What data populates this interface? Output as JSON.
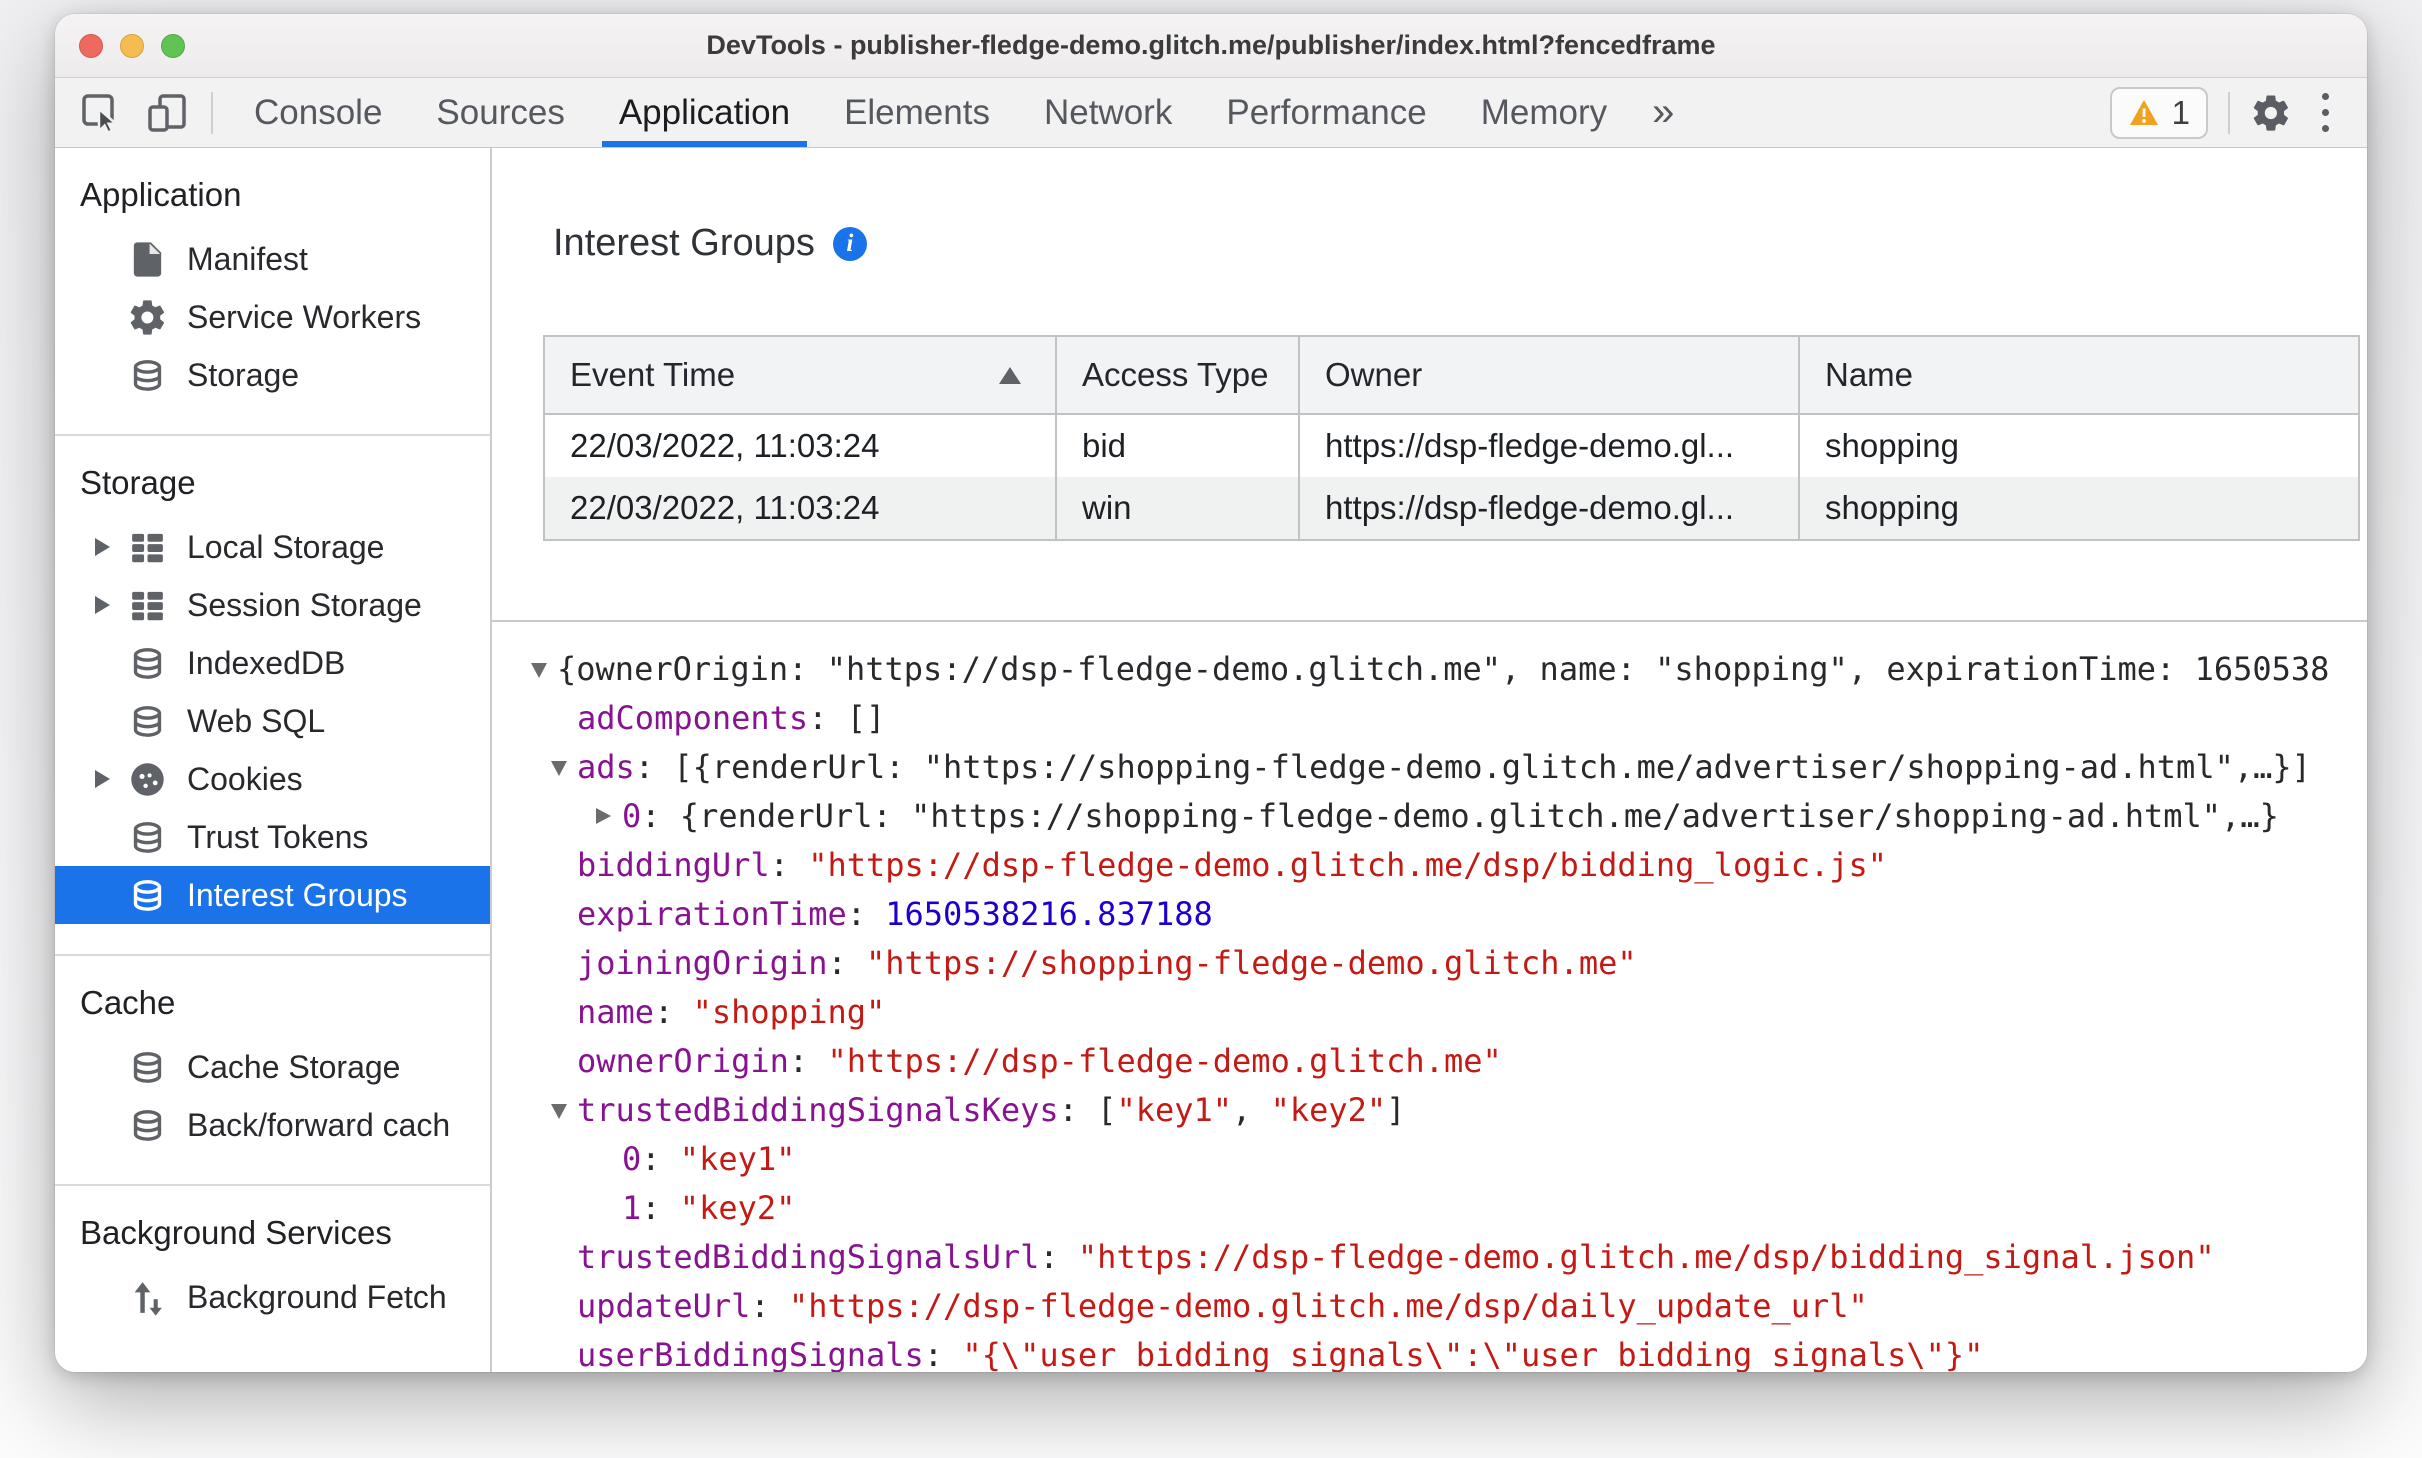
{
  "colors": {
    "accent": "#1a73e8",
    "warning": "#f0a11d",
    "json_key": "#881391",
    "json_string": "#c41a16",
    "json_number": "#1c00cf"
  },
  "window": {
    "title": "DevTools - publisher-fledge-demo.glitch.me/publisher/index.html?fencedframe"
  },
  "toolbar": {
    "tabs": [
      {
        "label": "Console",
        "selected": false
      },
      {
        "label": "Sources",
        "selected": false
      },
      {
        "label": "Application",
        "selected": true
      },
      {
        "label": "Elements",
        "selected": false
      },
      {
        "label": "Network",
        "selected": false
      },
      {
        "label": "Performance",
        "selected": false
      },
      {
        "label": "Memory",
        "selected": false
      }
    ],
    "more_tabs_symbol": "»",
    "warning_count": "1"
  },
  "sidebar": {
    "sections": [
      {
        "title": "Application",
        "items": [
          {
            "label": "Manifest",
            "icon": "document",
            "expander": false,
            "selected": false
          },
          {
            "label": "Service Workers",
            "icon": "gear",
            "expander": false,
            "selected": false
          },
          {
            "label": "Storage",
            "icon": "database",
            "expander": false,
            "selected": false
          }
        ]
      },
      {
        "title": "Storage",
        "items": [
          {
            "label": "Local Storage",
            "icon": "table",
            "expander": true,
            "selected": false
          },
          {
            "label": "Session Storage",
            "icon": "table",
            "expander": true,
            "selected": false
          },
          {
            "label": "IndexedDB",
            "icon": "database",
            "expander": false,
            "selected": false
          },
          {
            "label": "Web SQL",
            "icon": "database",
            "expander": false,
            "selected": false
          },
          {
            "label": "Cookies",
            "icon": "cookie",
            "expander": true,
            "selected": false
          },
          {
            "label": "Trust Tokens",
            "icon": "database",
            "expander": false,
            "selected": false
          },
          {
            "label": "Interest Groups",
            "icon": "database",
            "expander": false,
            "selected": true
          }
        ]
      },
      {
        "title": "Cache",
        "items": [
          {
            "label": "Cache Storage",
            "icon": "database",
            "expander": false,
            "selected": false
          },
          {
            "label": "Back/forward cach",
            "icon": "database",
            "expander": false,
            "selected": false
          }
        ]
      },
      {
        "title": "Background Services",
        "items": [
          {
            "label": "Background Fetch",
            "icon": "fetch",
            "expander": false,
            "selected": false
          }
        ]
      }
    ]
  },
  "main": {
    "title": "Interest Groups",
    "table": {
      "columns": [
        "Event Time",
        "Access Type",
        "Owner",
        "Name"
      ],
      "sorted_column": 0,
      "sort_direction": "asc",
      "rows": [
        [
          "22/03/2022, 11:03:24",
          "bid",
          "https://dsp-fledge-demo.gl...",
          "shopping"
        ],
        [
          "22/03/2022, 11:03:24",
          "win",
          "https://dsp-fledge-demo.gl...",
          "shopping"
        ]
      ]
    },
    "tree": {
      "lines": [
        {
          "indent": 0,
          "arrow": "down",
          "segments": [
            {
              "t": "plain",
              "v": "{ownerOrigin: \"https://dsp-fledge-demo.glitch.me\", name: \"shopping\", expirationTime: 1650538"
            }
          ]
        },
        {
          "indent": 1,
          "arrow": null,
          "segments": [
            {
              "t": "key",
              "v": "adComponents"
            },
            {
              "t": "plain",
              "v": ": []"
            }
          ]
        },
        {
          "indent": 1,
          "arrow": "down",
          "segments": [
            {
              "t": "key",
              "v": "ads"
            },
            {
              "t": "plain",
              "v": ": [{renderUrl: \"https://shopping-fledge-demo.glitch.me/advertiser/shopping-ad.html\",…}]"
            }
          ]
        },
        {
          "indent": 2,
          "arrow": "right",
          "segments": [
            {
              "t": "key",
              "v": "0"
            },
            {
              "t": "plain",
              "v": ": {renderUrl: \"https://shopping-fledge-demo.glitch.me/advertiser/shopping-ad.html\",…}"
            }
          ]
        },
        {
          "indent": 1,
          "arrow": null,
          "segments": [
            {
              "t": "key",
              "v": "biddingUrl"
            },
            {
              "t": "plain",
              "v": ": "
            },
            {
              "t": "str",
              "v": "\"https://dsp-fledge-demo.glitch.me/dsp/bidding_logic.js\""
            }
          ]
        },
        {
          "indent": 1,
          "arrow": null,
          "segments": [
            {
              "t": "key",
              "v": "expirationTime"
            },
            {
              "t": "plain",
              "v": ": "
            },
            {
              "t": "num",
              "v": "1650538216.837188"
            }
          ]
        },
        {
          "indent": 1,
          "arrow": null,
          "segments": [
            {
              "t": "key",
              "v": "joiningOrigin"
            },
            {
              "t": "plain",
              "v": ": "
            },
            {
              "t": "str",
              "v": "\"https://shopping-fledge-demo.glitch.me\""
            }
          ]
        },
        {
          "indent": 1,
          "arrow": null,
          "segments": [
            {
              "t": "key",
              "v": "name"
            },
            {
              "t": "plain",
              "v": ": "
            },
            {
              "t": "str",
              "v": "\"shopping\""
            }
          ]
        },
        {
          "indent": 1,
          "arrow": null,
          "segments": [
            {
              "t": "key",
              "v": "ownerOrigin"
            },
            {
              "t": "plain",
              "v": ": "
            },
            {
              "t": "str",
              "v": "\"https://dsp-fledge-demo.glitch.me\""
            }
          ]
        },
        {
          "indent": 1,
          "arrow": "down",
          "segments": [
            {
              "t": "key",
              "v": "trustedBiddingSignalsKeys"
            },
            {
              "t": "plain",
              "v": ": ["
            },
            {
              "t": "str",
              "v": "\"key1\""
            },
            {
              "t": "plain",
              "v": ", "
            },
            {
              "t": "str",
              "v": "\"key2\""
            },
            {
              "t": "plain",
              "v": "]"
            }
          ]
        },
        {
          "indent": 2,
          "arrow": null,
          "segments": [
            {
              "t": "key",
              "v": "0"
            },
            {
              "t": "plain",
              "v": ": "
            },
            {
              "t": "str",
              "v": "\"key1\""
            }
          ]
        },
        {
          "indent": 2,
          "arrow": null,
          "segments": [
            {
              "t": "key",
              "v": "1"
            },
            {
              "t": "plain",
              "v": ": "
            },
            {
              "t": "str",
              "v": "\"key2\""
            }
          ]
        },
        {
          "indent": 1,
          "arrow": null,
          "segments": [
            {
              "t": "key",
              "v": "trustedBiddingSignalsUrl"
            },
            {
              "t": "plain",
              "v": ": "
            },
            {
              "t": "str",
              "v": "\"https://dsp-fledge-demo.glitch.me/dsp/bidding_signal.json\""
            }
          ]
        },
        {
          "indent": 1,
          "arrow": null,
          "segments": [
            {
              "t": "key",
              "v": "updateUrl"
            },
            {
              "t": "plain",
              "v": ": "
            },
            {
              "t": "str",
              "v": "\"https://dsp-fledge-demo.glitch.me/dsp/daily_update_url\""
            }
          ]
        },
        {
          "indent": 1,
          "arrow": null,
          "segments": [
            {
              "t": "key",
              "v": "userBiddingSignals"
            },
            {
              "t": "plain",
              "v": ": "
            },
            {
              "t": "str",
              "v": "\"{\\\"user_bidding_signals\\\":\\\"user_bidding_signals\\\"}\""
            }
          ]
        }
      ]
    }
  }
}
